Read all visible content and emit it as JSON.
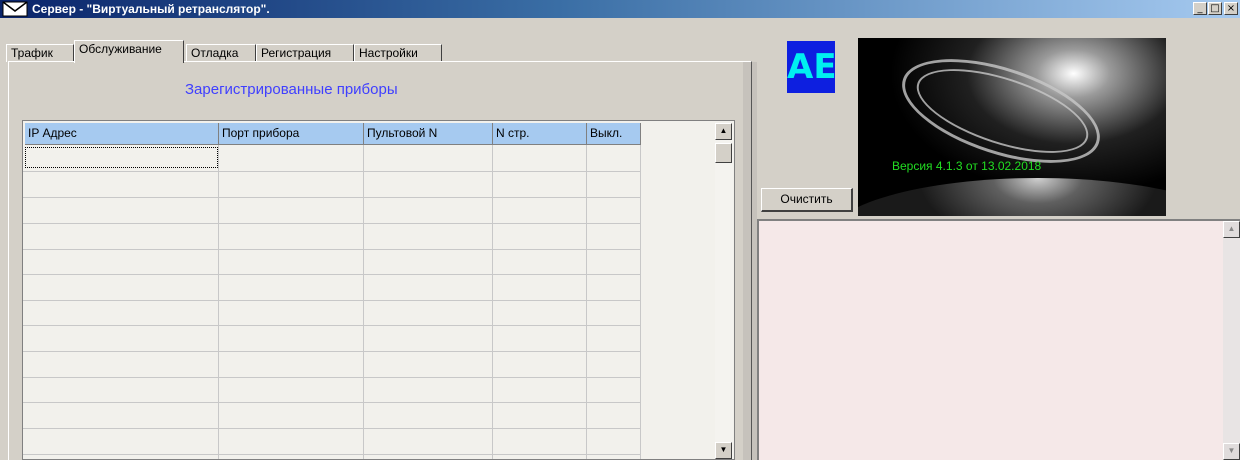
{
  "window": {
    "title": "Сервер - \"Виртуальный ретранслятор\".",
    "icon": "envelope-icon",
    "controls": {
      "minimize": "_",
      "maximize": "□",
      "close": "×"
    }
  },
  "tabs": [
    {
      "label": "Трафик",
      "active": false
    },
    {
      "label": "Обслуживание",
      "active": true
    },
    {
      "label": "Отладка",
      "active": false
    },
    {
      "label": "Регистрация",
      "active": false
    },
    {
      "label": "Настройки",
      "active": false
    }
  ],
  "panel": {
    "heading": "Зарегистрированные приборы",
    "heading_color": "#3f3fff"
  },
  "devices_table": {
    "columns": [
      "IP Адрес",
      "Порт прибора",
      "Пультовой N",
      "N стр.",
      "Выкл."
    ],
    "header_color": "#a6caf0",
    "rows": []
  },
  "right_panel": {
    "logo_text": "AE",
    "version_text": "Версия   4.1.3 от 13.02.2018",
    "version_color": "#22dd22",
    "clear_button": "Очистить",
    "log_background": "#f5e8e8"
  }
}
